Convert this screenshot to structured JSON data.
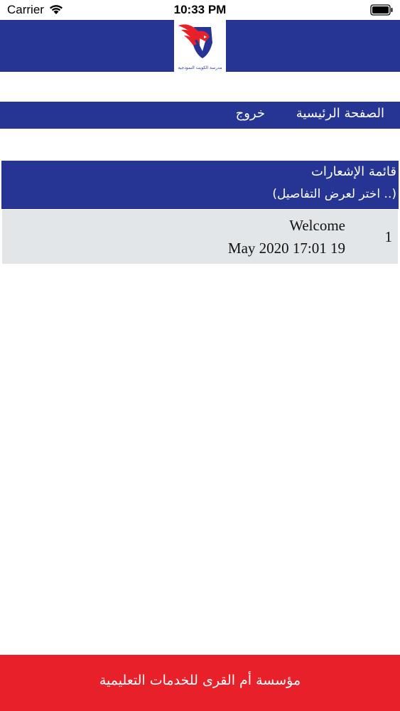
{
  "status_bar": {
    "carrier": "Carrier",
    "time": "10:33 PM"
  },
  "header": {
    "logo_text": "مدرسة الكويت النموذجية",
    "background_color": "#263594"
  },
  "nav": {
    "home_label": "الصفحة الرئيسية",
    "logout_label": "خروج"
  },
  "notifications": {
    "title": "قائمة الإشعارات",
    "subtitle": "(.. اختر لعرض التفاصيل)",
    "items": [
      {
        "index": "1",
        "title": "Welcome",
        "date": "May 2020 17:01 19"
      }
    ]
  },
  "footer": {
    "text": "مؤسسة أم القرى للخدمات التعليمية",
    "background_color": "#e8202a"
  }
}
